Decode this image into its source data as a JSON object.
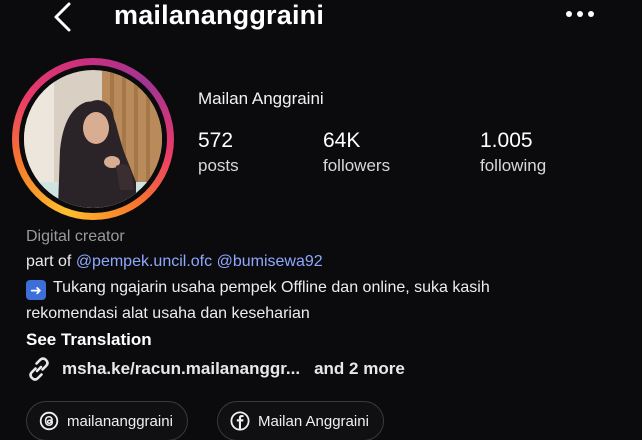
{
  "header": {
    "username": "mailananggraini"
  },
  "profile": {
    "display_name": "Mailan Anggraini",
    "stats": [
      {
        "value": "572",
        "label": "posts"
      },
      {
        "value": "64K",
        "label": "followers"
      },
      {
        "value": "1.005",
        "label": "following"
      }
    ]
  },
  "bio": {
    "category": "Digital creator",
    "part_of_prefix": "part of",
    "mention_1": "@pempek.uncil.ofc",
    "mention_2": "@bumisewa92",
    "line_1": "Tukang ngajarin usaha pempek Offline dan online, suka kasih",
    "line_2": "rekomendasi alat usaha dan keseharian",
    "see_translation": "See Translation",
    "link_text": "msha.ke/racun.mailananggr...",
    "link_more": "and 2 more"
  },
  "chips": [
    {
      "icon": "threads-icon",
      "label": "mailananggraini"
    },
    {
      "icon": "facebook-icon",
      "label": "Mailan Anggraini"
    }
  ],
  "colors": {
    "background": "#0b0b0d",
    "mention": "#8ea8ff",
    "muted": "#9a9a9a"
  }
}
